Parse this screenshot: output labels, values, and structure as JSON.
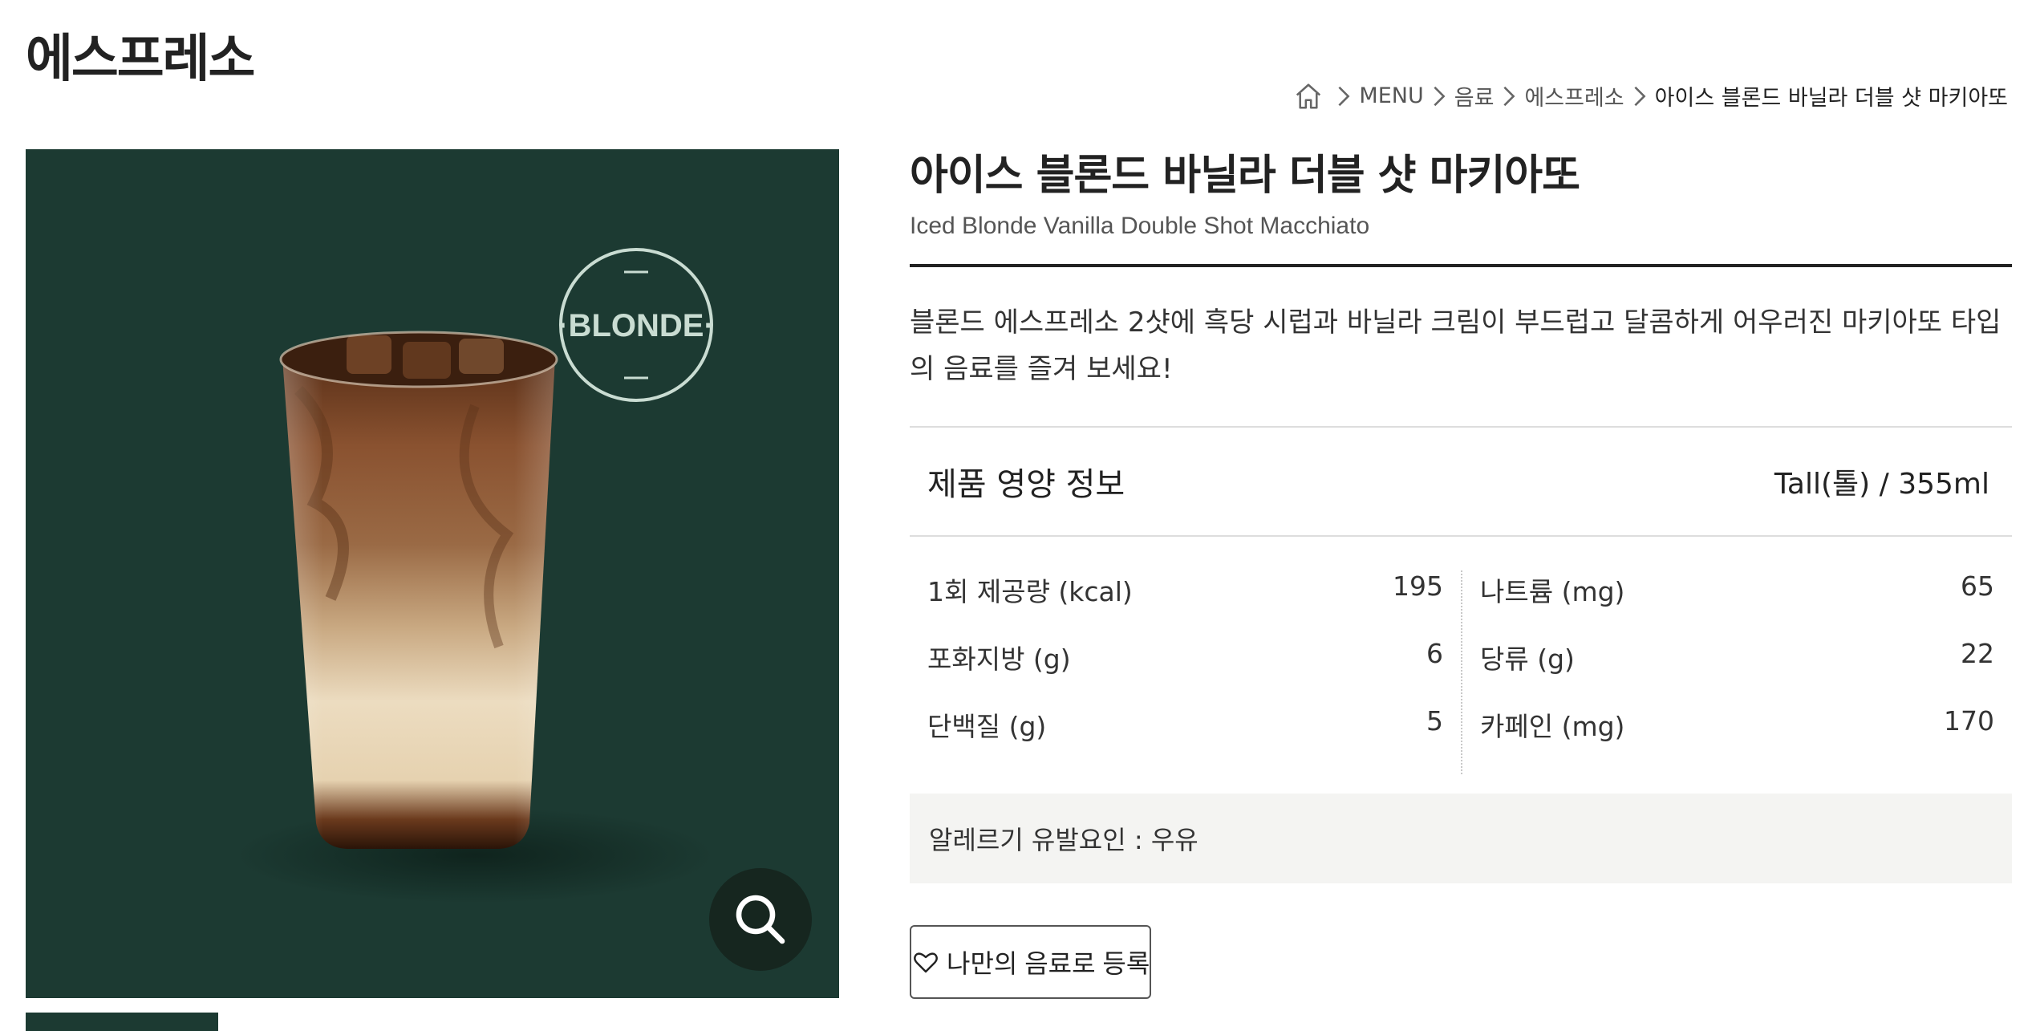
{
  "page": {
    "heading": "에스프레소"
  },
  "breadcrumb": {
    "items": [
      "MENU",
      "음료",
      "에스프레소"
    ],
    "current": "아이스 블론드 바닐라 더블 샷 마키아또"
  },
  "image": {
    "badge_text": "·BLONDE·"
  },
  "product": {
    "title_ko": "아이스 블론드 바닐라 더블 샷 마키아또",
    "title_en": "Iced Blonde Vanilla Double Shot Macchiato",
    "description": "블론드 에스프레소 2샷에 흑당 시럽과 바닐라 크림이 부드럽고 달콤하게 어우러진 마키아또 타입의 음료를 즐겨 보세요!"
  },
  "nutrition": {
    "title": "제품 영양 정보",
    "size_label": "Tall(톨) / 355ml",
    "left": [
      {
        "label": "1회 제공량 (kcal)",
        "value": "195"
      },
      {
        "label": "포화지방 (g)",
        "value": "6"
      },
      {
        "label": "단백질 (g)",
        "value": "5"
      }
    ],
    "right": [
      {
        "label": "나트륨 (mg)",
        "value": "65"
      },
      {
        "label": "당류 (g)",
        "value": "22"
      },
      {
        "label": "카페인 (mg)",
        "value": "170"
      }
    ]
  },
  "allergy": {
    "text": "알레르기 유발요인 : 우유"
  },
  "favorite_button": {
    "label": "나만의 음료로 등록"
  },
  "colors": {
    "image_bg": "#1c3a32",
    "zoom_bg": "#16261f",
    "allergy_bg": "#f4f4f2"
  }
}
